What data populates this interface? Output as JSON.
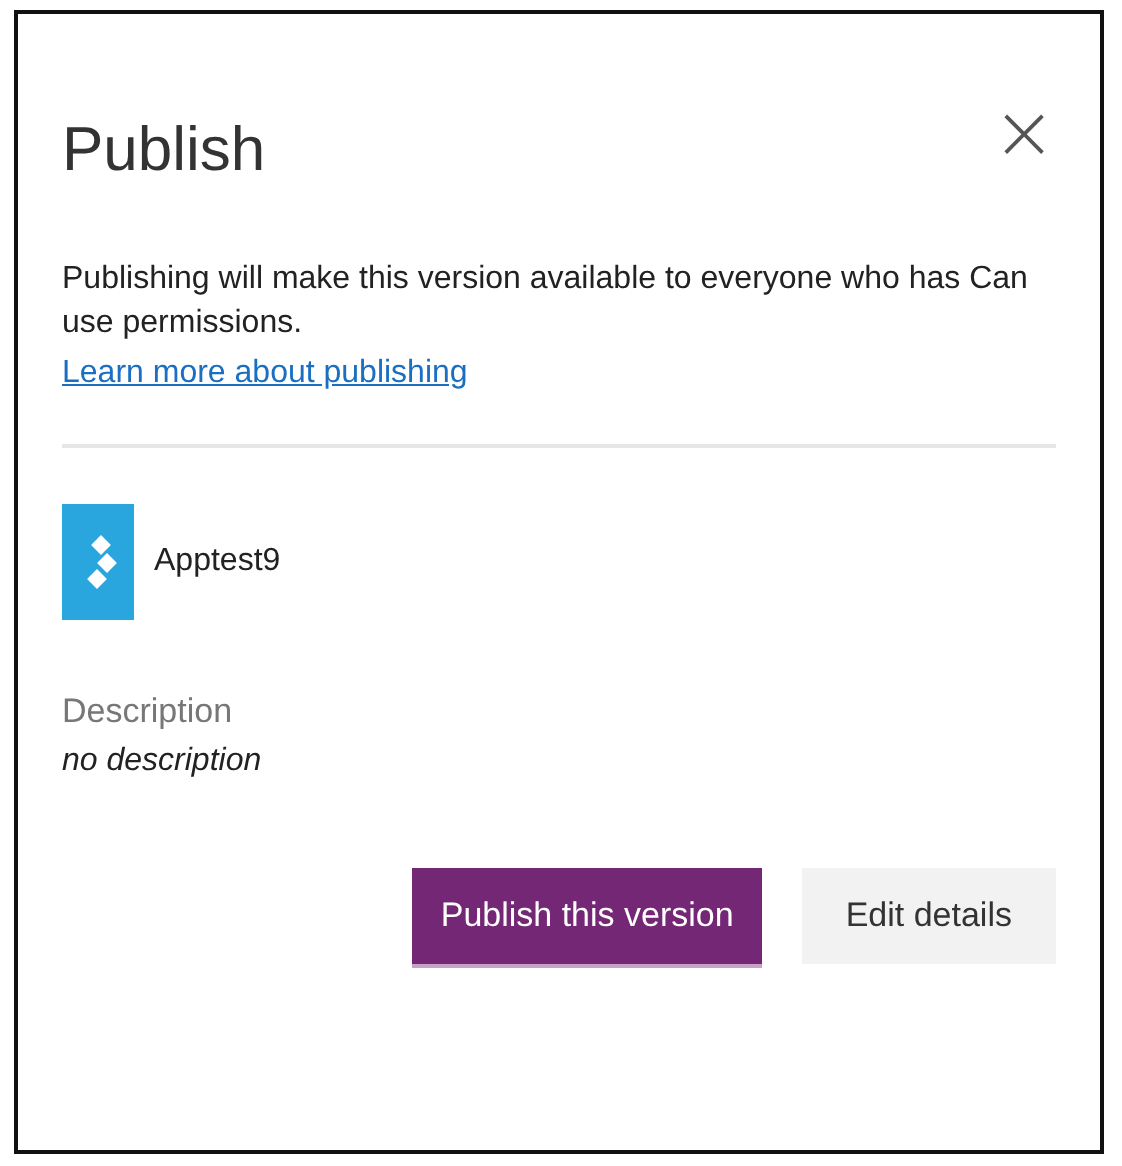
{
  "dialog": {
    "title": "Publish",
    "close": "×",
    "message": "Publishing will make this version available to everyone who has Can use permissions.",
    "link": "Learn more about publishing",
    "app": {
      "name": "Apptest9"
    },
    "description_label": "Description",
    "description": "no description",
    "buttons": [
      {
        "label": "Publish this version",
        "kind": "primary"
      },
      {
        "label": "Edit details",
        "kind": "secondary"
      }
    ]
  }
}
